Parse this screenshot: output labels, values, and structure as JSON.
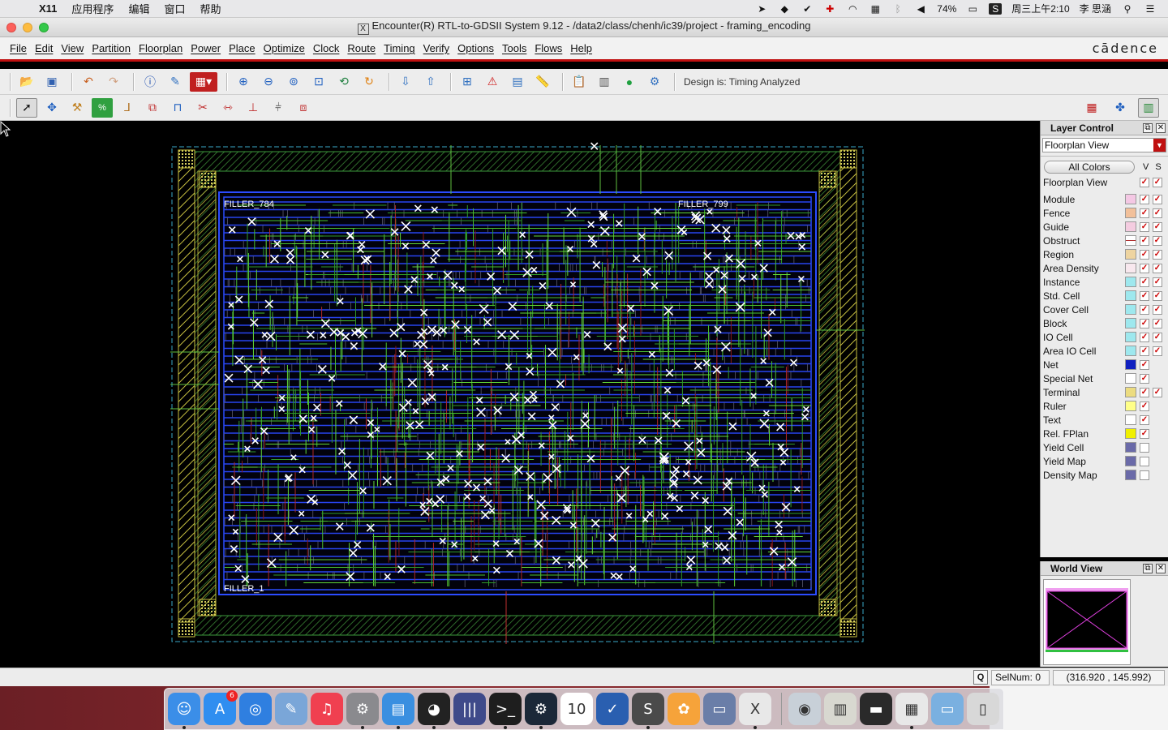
{
  "macbar": {
    "app": "X11",
    "menus": [
      "应用程序",
      "编辑",
      "窗口",
      "帮助"
    ],
    "battery": "74%",
    "datetime": "周三上午2:10",
    "user": "李 思涵"
  },
  "window": {
    "title": "Encounter(R) RTL-to-GDSII System 9.12 - /data2/class/chenh/ic39/project - framing_encoding"
  },
  "menu": {
    "items": [
      "File",
      "Edit",
      "View",
      "Partition",
      "Floorplan",
      "Power",
      "Place",
      "Optimize",
      "Clock",
      "Route",
      "Timing",
      "Verify",
      "Options",
      "Tools",
      "Flows",
      "Help"
    ],
    "brand": "cādence"
  },
  "toolbar": {
    "design_status": "Design is: Timing Analyzed"
  },
  "canvas": {
    "labels": {
      "filler_tl": "FILLER_784",
      "filler_tr": "FILLER_799",
      "filler_bl": "FILLER_1"
    }
  },
  "layer_control": {
    "title": "Layer Control",
    "view_select": "Floorplan View",
    "all_colors": "All Colors",
    "col_v": "V",
    "col_s": "S",
    "layers": [
      {
        "name": "Floorplan View",
        "color": "",
        "v": true,
        "s": true
      },
      {
        "name": "Module",
        "color": "#f4c8e4",
        "v": true,
        "s": true
      },
      {
        "name": "Fence",
        "color": "#f2c09a",
        "v": true,
        "s": true
      },
      {
        "name": "Guide",
        "color": "#f4cce0",
        "v": true,
        "s": true
      },
      {
        "name": "Obstruct",
        "color": "#ffffff",
        "v": true,
        "s": true
      },
      {
        "name": "Region",
        "color": "#eed4a0",
        "v": true,
        "s": true
      },
      {
        "name": "Area Density",
        "color": "#f8e8ee",
        "v": true,
        "s": true
      },
      {
        "name": "Instance",
        "color": "#9ee8ee",
        "v": true,
        "s": true
      },
      {
        "name": "Std. Cell",
        "color": "#9ee8ee",
        "v": true,
        "s": true
      },
      {
        "name": "Cover Cell",
        "color": "#9ee8ee",
        "v": true,
        "s": true
      },
      {
        "name": "Block",
        "color": "#9ee8ee",
        "v": true,
        "s": true
      },
      {
        "name": "IO Cell",
        "color": "#9ee8ee",
        "v": true,
        "s": true
      },
      {
        "name": "Area IO Cell",
        "color": "#9ee8ee",
        "v": true,
        "s": true
      },
      {
        "name": "Net",
        "color": "#1020c0",
        "v": true,
        "s": null
      },
      {
        "name": "Special Net",
        "color": "#ffffff",
        "v": true,
        "s": null
      },
      {
        "name": "Terminal",
        "color": "#ecdc80",
        "v": true,
        "s": true
      },
      {
        "name": "Ruler",
        "color": "#ffff88",
        "v": true,
        "s": null
      },
      {
        "name": "Text",
        "color": "#ffffff",
        "v": true,
        "s": null
      },
      {
        "name": "Rel. FPlan",
        "color": "#f0f000",
        "v": true,
        "s": null
      },
      {
        "name": "Yield Cell",
        "color": "#6a6aa8",
        "v": false,
        "s": null
      },
      {
        "name": "Yield Map",
        "color": "#6a6aa8",
        "v": false,
        "s": null
      },
      {
        "name": "Density Map",
        "color": "#6a6aa8",
        "v": false,
        "s": null
      }
    ]
  },
  "world_view": {
    "title": "World View"
  },
  "statusbar": {
    "q": "Q",
    "selnum": "SelNum: 0",
    "coords": "(316.920 , 145.992)"
  },
  "dock": {
    "apps": [
      {
        "name": "finder",
        "glyph": "☺",
        "color": "#3b8ee8"
      },
      {
        "name": "app-store",
        "glyph": "A",
        "color": "#2f8ef0",
        "badge": "6"
      },
      {
        "name": "safari",
        "glyph": "◎",
        "color": "#2f7fe0"
      },
      {
        "name": "preview",
        "glyph": "✎",
        "color": "#7aa6d8"
      },
      {
        "name": "music",
        "glyph": "♫",
        "color": "#f04050"
      },
      {
        "name": "system-preferences",
        "glyph": "⚙",
        "color": "#8a8a8e"
      },
      {
        "name": "activity-monitor",
        "glyph": "▤",
        "color": "#3a8fe0"
      },
      {
        "name": "qq",
        "glyph": "◕",
        "color": "#222222"
      },
      {
        "name": "library",
        "glyph": "|||",
        "color": "#3f4a8a"
      },
      {
        "name": "terminal",
        "glyph": ">_",
        "color": "#1e1e1e"
      },
      {
        "name": "steam",
        "glyph": "⚙",
        "color": "#1b2838"
      },
      {
        "name": "calendar",
        "glyph": "10",
        "color": "#ffffff"
      },
      {
        "name": "reminders",
        "glyph": "✓",
        "color": "#2a5fb0"
      },
      {
        "name": "sublime-text",
        "glyph": "S",
        "color": "#4a4a4a"
      },
      {
        "name": "photos",
        "glyph": "✿",
        "color": "#f6a33a"
      },
      {
        "name": "image-capture",
        "glyph": "▭",
        "color": "#6a7ea8"
      },
      {
        "name": "x11",
        "glyph": "X",
        "color": "#e8e8e8"
      }
    ],
    "right": [
      {
        "name": "downloads",
        "glyph": "◉",
        "color": "#c8d0d8"
      },
      {
        "name": "archive",
        "glyph": "▥",
        "color": "#d8d8d0"
      },
      {
        "name": "screen",
        "glyph": "▬",
        "color": "#2a2a2a"
      },
      {
        "name": "documents",
        "glyph": "▦",
        "color": "#e8e8e8"
      },
      {
        "name": "folder",
        "glyph": "▭",
        "color": "#7ab0e0"
      },
      {
        "name": "trash",
        "glyph": "▯",
        "color": "#d8d8d8"
      }
    ]
  }
}
